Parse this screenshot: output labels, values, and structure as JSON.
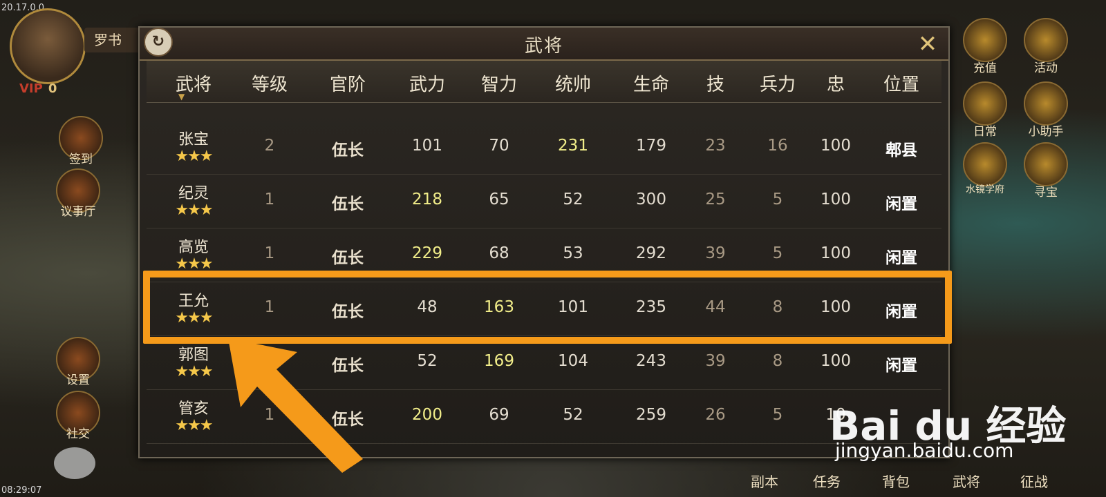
{
  "app": {
    "version": "20.17.0.0",
    "clock": "08:29:07"
  },
  "player": {
    "name": "罗书",
    "vip_label": "VIP",
    "vip_level": "0"
  },
  "left_menu": [
    "签到",
    "议事厅",
    "设置",
    "社交"
  ],
  "right_menu": [
    "充值",
    "活动",
    "日常",
    "小助手",
    "水镜学府",
    "寻宝"
  ],
  "bottom_tabs": [
    "副本",
    "任务",
    "背包",
    "武将",
    "征战"
  ],
  "panel": {
    "title": "武将",
    "close_glyph": "✕",
    "refresh_glyph": "↻"
  },
  "table": {
    "headers": [
      "武将",
      "等级",
      "官阶",
      "武力",
      "智力",
      "统帅",
      "生命",
      "技",
      "兵力",
      "忠",
      "位置"
    ],
    "rows": [
      {
        "name": "张宝",
        "stars": "★★★",
        "level": "2",
        "rank": "伍长",
        "force": "101",
        "intel": "70",
        "command": "231",
        "hp": "179",
        "skill": "23",
        "troops": "16",
        "loyalty": "100",
        "position": "郫县"
      },
      {
        "name": "纪灵",
        "stars": "★★★",
        "level": "1",
        "rank": "伍长",
        "force": "218",
        "intel": "65",
        "command": "52",
        "hp": "300",
        "skill": "25",
        "troops": "5",
        "loyalty": "100",
        "position": "闲置"
      },
      {
        "name": "高览",
        "stars": "★★★",
        "level": "1",
        "rank": "伍长",
        "force": "229",
        "intel": "68",
        "command": "53",
        "hp": "292",
        "skill": "39",
        "troops": "5",
        "loyalty": "100",
        "position": "闲置"
      },
      {
        "name": "王允",
        "stars": "★★★",
        "level": "1",
        "rank": "伍长",
        "force": "48",
        "intel": "163",
        "command": "101",
        "hp": "235",
        "skill": "44",
        "troops": "8",
        "loyalty": "100",
        "position": "闲置"
      },
      {
        "name": "郭图",
        "stars": "★★★",
        "level": "",
        "rank": "伍长",
        "force": "52",
        "intel": "169",
        "command": "104",
        "hp": "243",
        "skill": "39",
        "troops": "8",
        "loyalty": "100",
        "position": "闲置"
      },
      {
        "name": "管亥",
        "stars": "★★★",
        "level": "1",
        "rank": "伍长",
        "force": "200",
        "intel": "69",
        "command": "52",
        "hp": "259",
        "skill": "26",
        "troops": "5",
        "loyalty": "10",
        "position": ""
      }
    ]
  },
  "watermark": {
    "brand": "Bai du 经验",
    "url": "jingyan.baidu.com"
  },
  "colors": {
    "highlight_box": "#f59a1a",
    "high_stat": "#f2ee8a",
    "star": "#f6c84a"
  }
}
